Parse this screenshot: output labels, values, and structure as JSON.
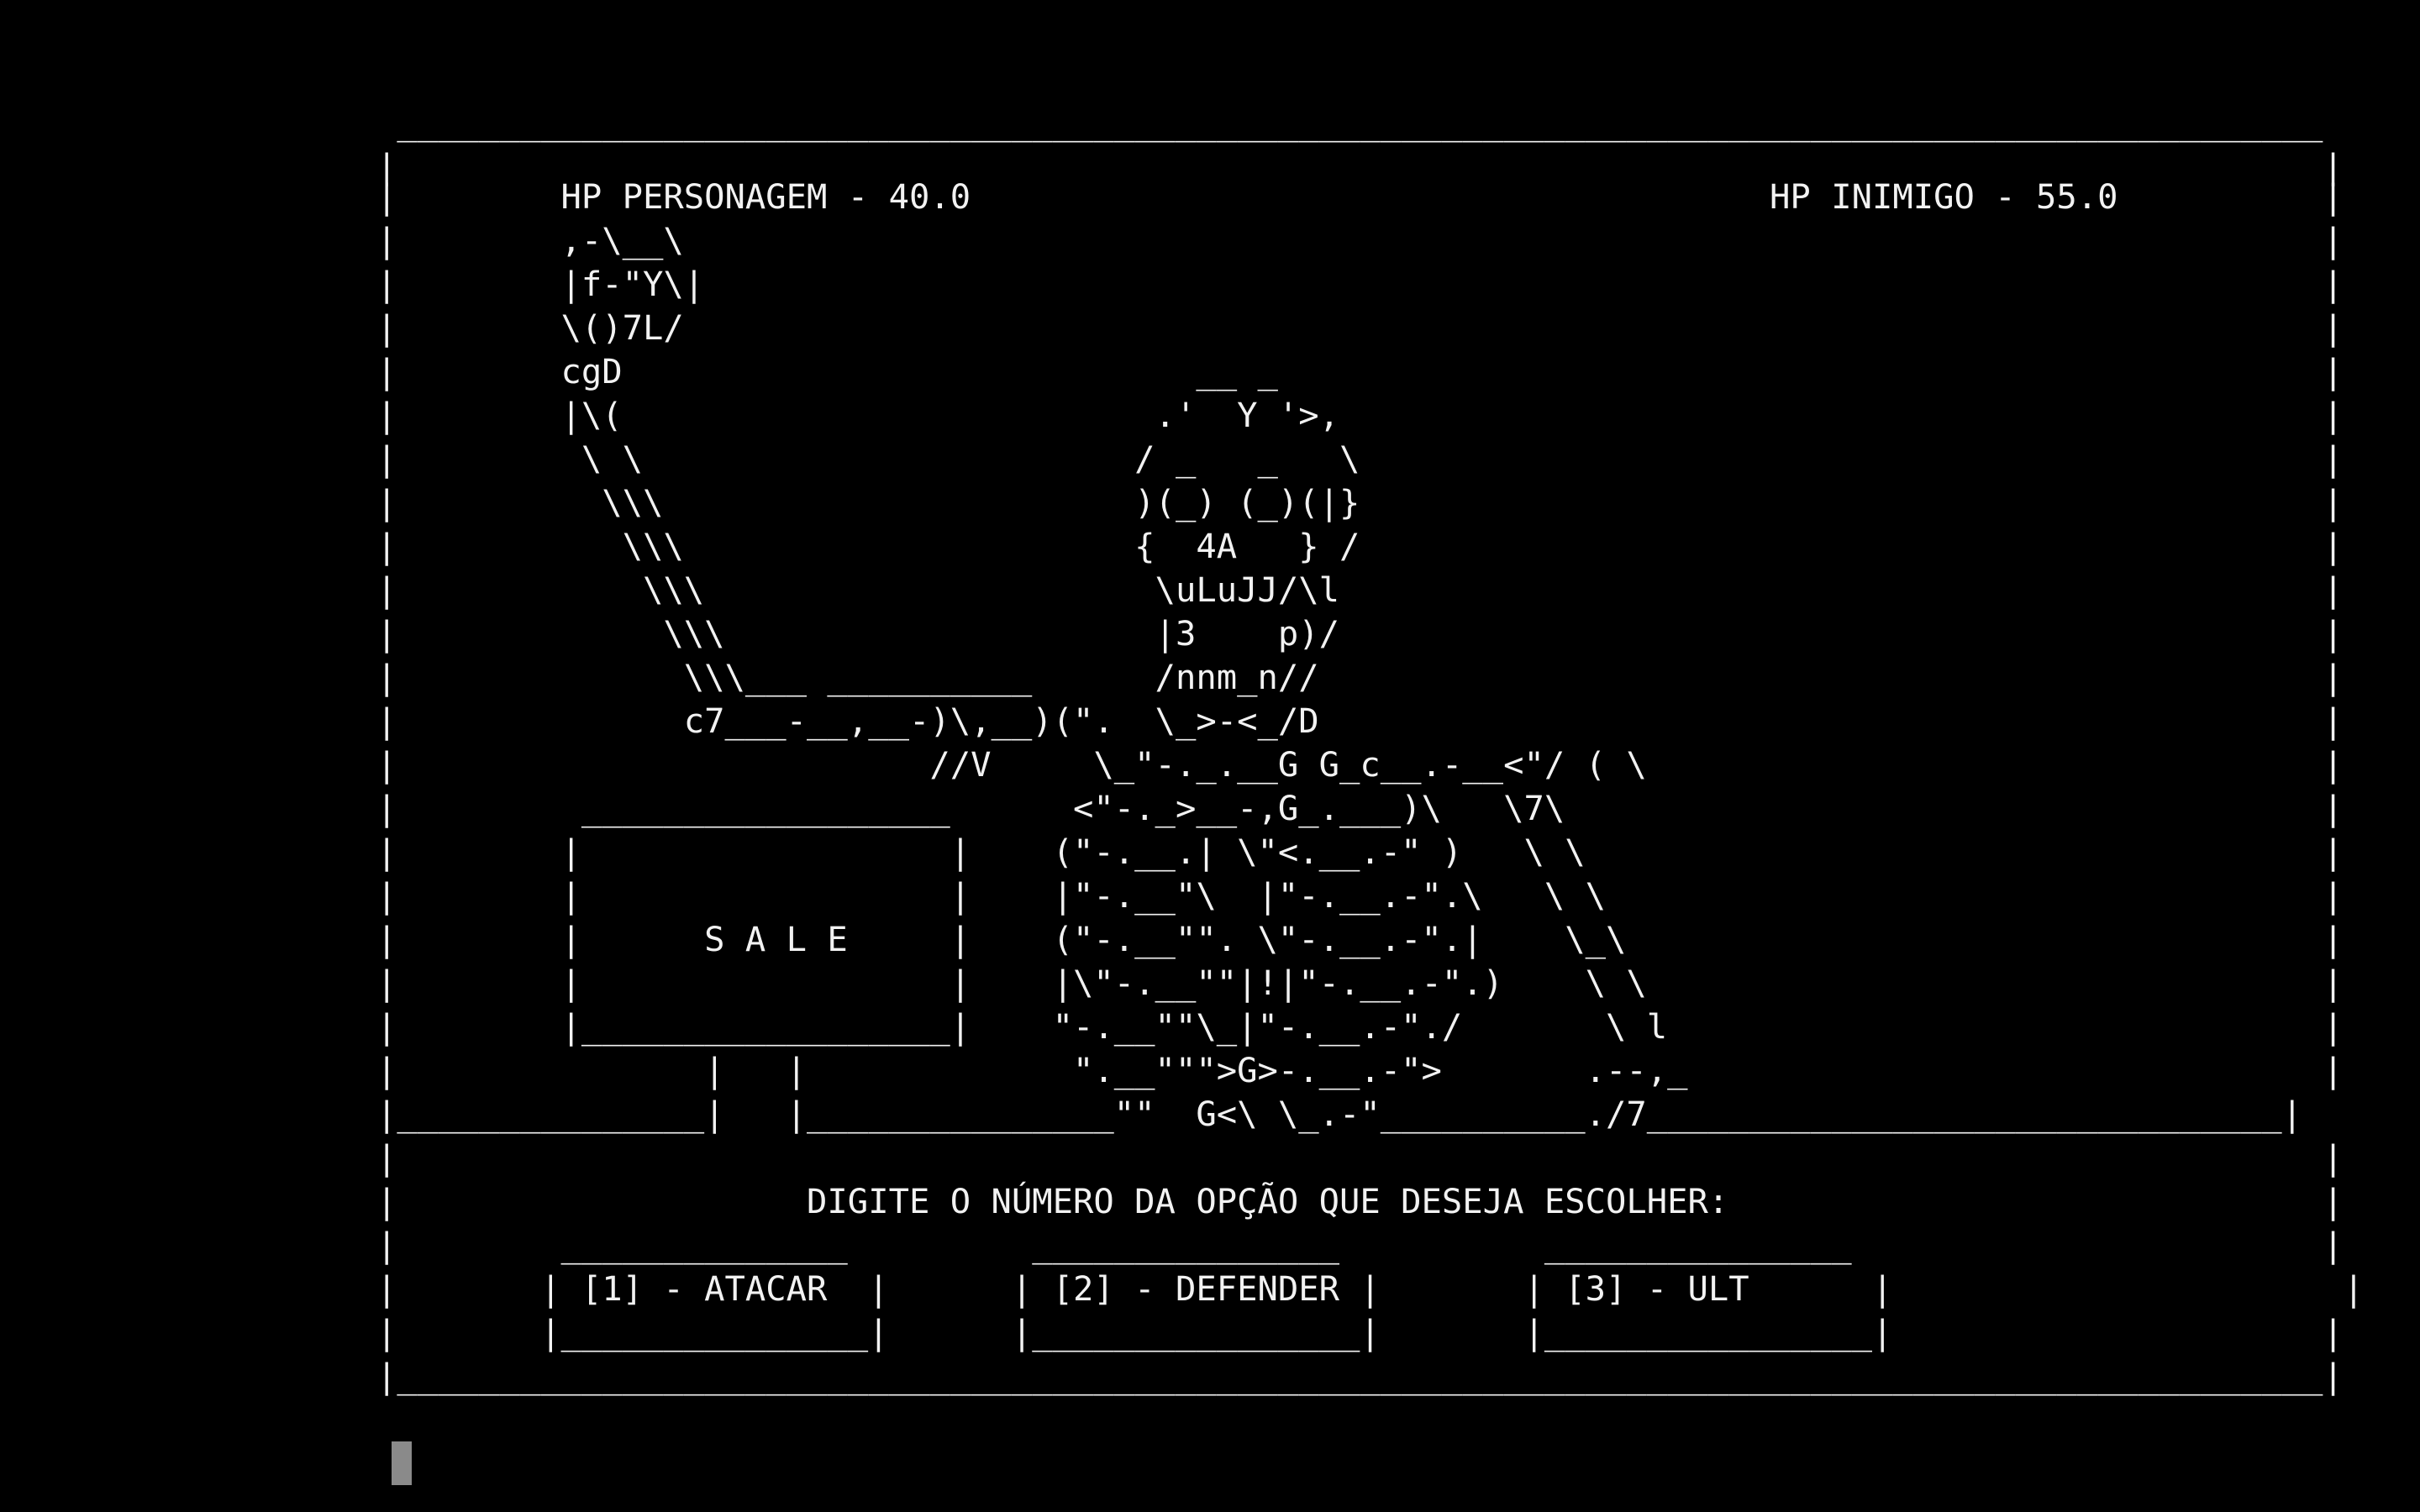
{
  "game": {
    "hp_player_label": "HP PERSONAGEM - 40.0",
    "hp_enemy_label": "HP INIMIGO - 55.0",
    "sign_text": "S A L E",
    "prompt": "DIGITE O NÚMERO DA OPÇÃO QUE DESEJA ESCOLHER:",
    "options": [
      {
        "label": "[1] - ATACAR"
      },
      {
        "label": "[2] - DEFENDER"
      },
      {
        "label": "[3] - ULT"
      }
    ]
  },
  "screen": {
    "lines": [
      " ______________________________________________________________________________________________",
      "|                                                                                              |",
      "|        HP PERSONAGEM - 40.0                                       HP INIMIGO - 55.0          |",
      "|        ,-\\__\\                                                                                |",
      "|        |f-\"Y\\|                                                                               |",
      "|        \\()7L/                                                                                |",
      "|        cgD                            __ _                                                   |",
      "|        |\\(                          .'  Y '>,                                                |",
      "|         \\ \\                        / _   _   \\                                               |",
      "|          \\\\\\                       )(_) (_)(|}                                               |",
      "|           \\\\\\                      {  4A   } /                                               |",
      "|            \\\\\\                      \\uLuJJ/\\l                                                |",
      "|             \\\\\\                     |3    p)/                                                |",
      "|              \\\\\\___ __________      /nnm_n//                                                 |",
      "|              c7___-__,__-)\\,__)(\".  \\_>-<_/D                                                 |",
      "|                          //V     \\_\"-._.__G G_c__.-__<\"/ ( \\                                 |",
      "|         __________________      <\"-._>__-,G_.___)\\   \\7\\                                     |",
      "|        |                  |    (\"-.__.| \\\"<.__.-\" )   \\ \\                                    |",
      "|        |                  |    |\"-.__\"\\  |\"-.__.-\".\\   \\ \\                                   |",
      "|        |      S A L E     |    (\"-.__\"\". \\\"-.__.-\".|    \\_\\                                  |",
      "|        |                  |    |\\\"-.__\"\"|!|\"-.__.-\".)    \\ \\                                 |",
      "|        |__________________|    \"-.__\"\"\\_|\"-.__.-\"./       \\ l                                |",
      "|               |   |             \".__\"\"\">G>-.__.-\">       .--,_                               |",
      "|_______________|   |_______________\"\"  G<\\ \\_.-\"__________./7_______________________________|",
      "|                                                                                              |",
      "|                    DIGITE O NÚMERO DA OPÇÃO QUE DESEJA ESCOLHER:                             |",
      "|        ______________         _______________          _______________                       |",
      "|       | [1] - ATACAR  |      | [2] - DEFENDER |       | [3] - ULT      |                      |",
      "|       |_______________|      |________________|       |________________|                     |",
      "|______________________________________________________________________________________________|"
    ]
  }
}
